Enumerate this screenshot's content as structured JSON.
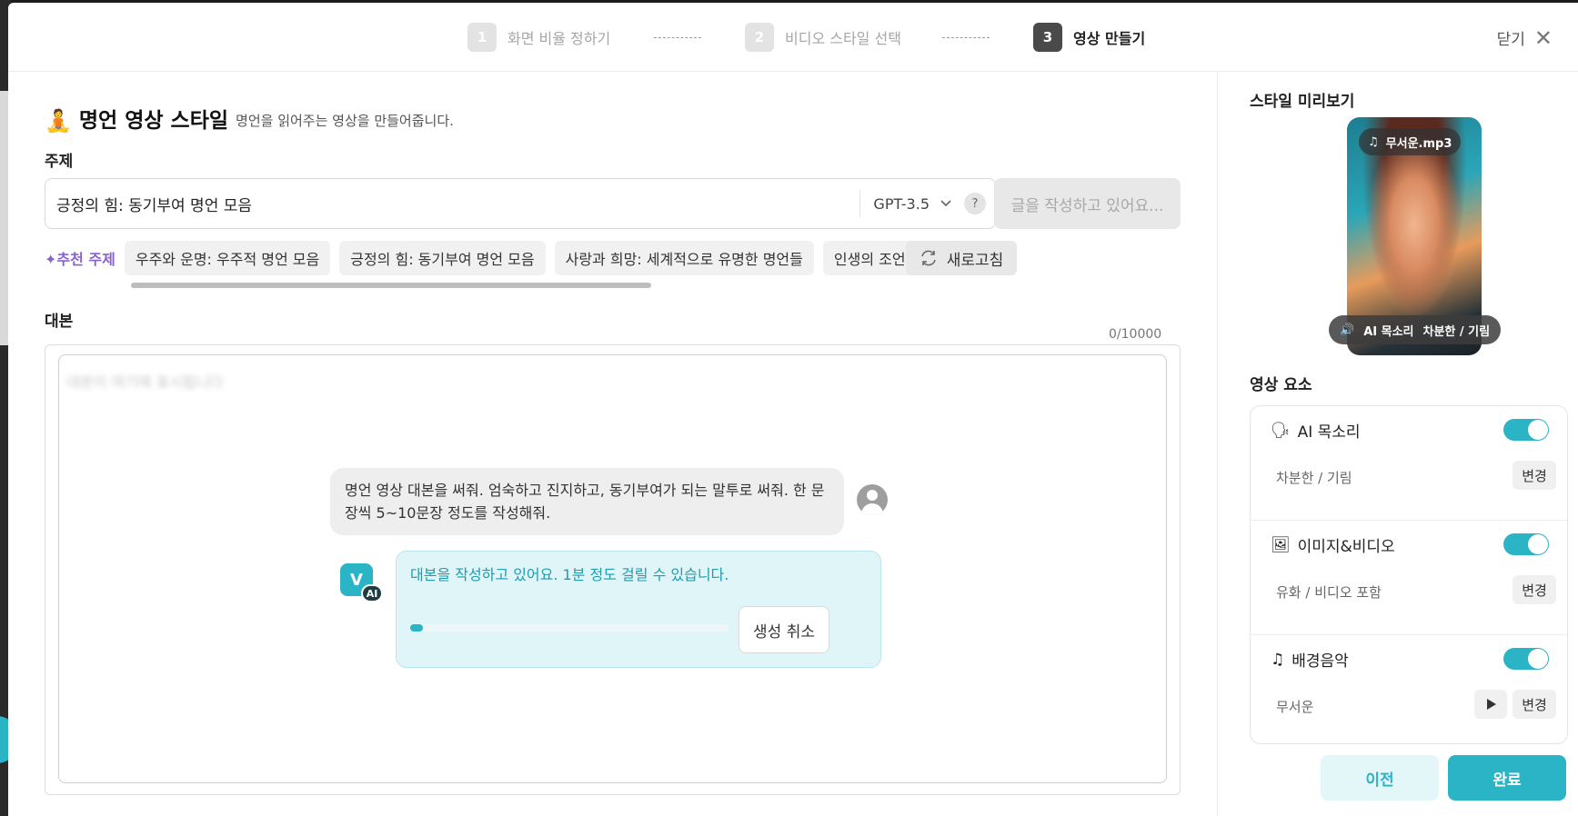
{
  "stepper": {
    "steps": [
      {
        "num": "1",
        "label": "화면 비율 정하기"
      },
      {
        "num": "2",
        "label": "비디오 스타일 선택"
      },
      {
        "num": "3",
        "label": "영상 만들기"
      }
    ],
    "active_step": 3,
    "close_label": "닫기"
  },
  "style": {
    "icon": "🧘",
    "title": "명언 영상 스타일",
    "description": "명언을 읽어주는 영상을 만들어줍니다."
  },
  "topic": {
    "label": "주제",
    "value": "긍정의 힘: 동기부여 명언 모음",
    "model": "GPT-3.5",
    "help": "?",
    "generate_label": "글을 작성하고 있어요..."
  },
  "recommendations": {
    "label": "추천 주제",
    "items": [
      "우주와 운명: 우주적 명언 모음",
      "긍정의 힘: 동기부여 명언 모음",
      "사랑과 희망: 세계적으로 유명한 명언들",
      "인생의 조언: 고"
    ],
    "refresh_label": "새로고침"
  },
  "script": {
    "label": "대본",
    "counter": "0/10000",
    "placeholder": "대본이 여기에 표시됩니다",
    "user_message": "명언 영상 대본을 써줘. 엄숙하고 진지하고, 동기부여가 되는 말투로 써줘. 한 문장씩 5~10문장 정도를 작성해줘.",
    "ai_badge": "AI",
    "ai_message": "대본을 작성하고 있어요. 1분 정도 걸릴 수 있습니다.",
    "progress": 0.04,
    "cancel_label": "생성 취소"
  },
  "preview": {
    "label": "스타일 미리보기",
    "music_tag": "무서운.mp3",
    "voice_tag_label": "AI 목소리",
    "voice_tag_value": "차분한 / 기림"
  },
  "elements": {
    "label": "영상 요소",
    "items": [
      {
        "name": "AI 목소리",
        "value": "차분한 / 기림",
        "enabled": true,
        "change": "변경"
      },
      {
        "name": "이미지&비디오",
        "value": "유화 / 비디오 포함",
        "enabled": true,
        "change": "변경"
      },
      {
        "name": "배경음악",
        "value": "무서운",
        "enabled": true,
        "change": "변경"
      }
    ]
  },
  "footer": {
    "prev_label": "이전",
    "done_label": "완료"
  },
  "colors": {
    "accent": "#2bb3c6",
    "recommend": "#8a63d2"
  }
}
